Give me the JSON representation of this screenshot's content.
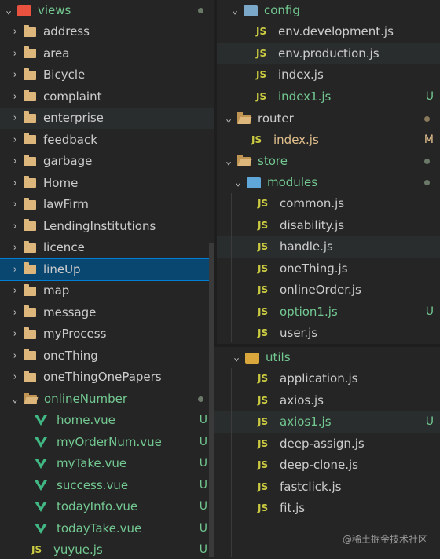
{
  "left": {
    "root": {
      "label": "views"
    },
    "folders": [
      "address",
      "area",
      "Bicycle",
      "complaint",
      "enterprise",
      "feedback",
      "garbage",
      "Home",
      "lawFirm",
      "LendingInstitutions",
      "licence",
      "lineUp",
      "map",
      "message",
      "myProcess",
      "oneThing",
      "oneThingOnePapers"
    ],
    "online_folder": {
      "label": "onlineNumber"
    },
    "files": [
      {
        "name": "home.vue",
        "badge": "U"
      },
      {
        "name": "myOrderNum.vue",
        "badge": "U"
      },
      {
        "name": "myTake.vue",
        "badge": "U"
      },
      {
        "name": "success.vue",
        "badge": "U"
      },
      {
        "name": "todayInfo.vue",
        "badge": "U"
      },
      {
        "name": "todayTake.vue",
        "badge": "U"
      },
      {
        "name": "yuyue.js",
        "badge": "U"
      }
    ]
  },
  "config_panel": {
    "folder": "config",
    "files": [
      {
        "name": "env.development.js",
        "badge": ""
      },
      {
        "name": "env.production.js",
        "badge": ""
      },
      {
        "name": "index.js",
        "badge": ""
      },
      {
        "name": "index1.js",
        "badge": "U"
      }
    ]
  },
  "store_panel": {
    "router": "router",
    "router_file": {
      "name": "index.js",
      "badge": "M"
    },
    "store": "store",
    "modules": "modules",
    "files": [
      {
        "name": "common.js",
        "badge": ""
      },
      {
        "name": "disability.js",
        "badge": ""
      },
      {
        "name": "handle.js",
        "badge": ""
      },
      {
        "name": "oneThing.js",
        "badge": ""
      },
      {
        "name": "onlineOrder.js",
        "badge": ""
      },
      {
        "name": "option1.js",
        "badge": "U"
      },
      {
        "name": "user.js",
        "badge": ""
      }
    ]
  },
  "utils_panel": {
    "folder": "utils",
    "files": [
      {
        "name": "application.js",
        "badge": ""
      },
      {
        "name": "axios.js",
        "badge": ""
      },
      {
        "name": "axios1.js",
        "badge": "U"
      },
      {
        "name": "deep-assign.js",
        "badge": ""
      },
      {
        "name": "deep-clone.js",
        "badge": ""
      },
      {
        "name": "fastclick.js",
        "badge": ""
      },
      {
        "name": "fit.js",
        "badge": ""
      }
    ]
  },
  "icons": {
    "chevron_right": "›",
    "chevron_down": "⌄",
    "js": "JS"
  },
  "watermark": "@稀土掘金技术社区"
}
